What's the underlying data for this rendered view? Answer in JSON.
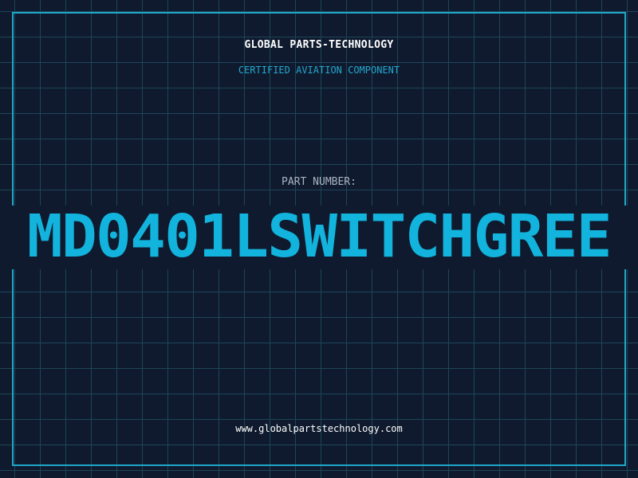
{
  "header": {
    "company": "GLOBAL PARTS-TECHNOLOGY",
    "tagline": "CERTIFIED AVIATION COMPONENT"
  },
  "part": {
    "label": "PART NUMBER:",
    "number": "MD0401LSWITCHGREE"
  },
  "footer": {
    "url": "www.globalpartstechnology.com"
  },
  "colors": {
    "background": "#0f1a2e",
    "grid": "#1d4658",
    "accent": "#12b3dc",
    "frame": "#1fa8c8",
    "text": "#ffffff",
    "muted": "#a9b4c4"
  }
}
